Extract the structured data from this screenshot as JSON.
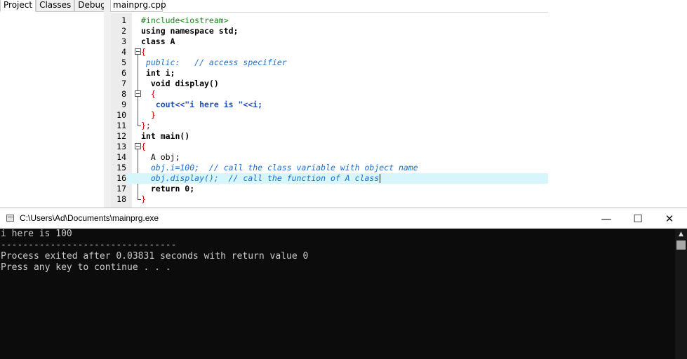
{
  "ide": {
    "left_tabs": [
      "Project",
      "Classes",
      "Debug"
    ],
    "file_tab": "mainprg.cpp",
    "line_numbers": [
      "1",
      "2",
      "3",
      "4",
      "5",
      "6",
      "7",
      "8",
      "9",
      "10",
      "11",
      "12",
      "13",
      "14",
      "15",
      "16",
      "17",
      "18"
    ],
    "lines": {
      "l1": "#include<iostream>",
      "l2": "using namespace std;",
      "l3": "class A",
      "l4": "{",
      "l5": " public:   // access specifier",
      "l6": " int i;",
      "l7": "  void display()",
      "l8": "  {",
      "l9": "   cout<<\"i here is \"<<i;",
      "l10": "  }",
      "l11": "};",
      "l12": "int main()",
      "l13": "{",
      "l14": "  A obj;",
      "l15": "  obj.i=100;  // call the class variable with object name",
      "l16": "  obj.display();  // call the function of A class",
      "l17": "  return 0;",
      "l18": "}"
    }
  },
  "console": {
    "title": "C:\\Users\\Ad\\Documents\\mainprg.exe",
    "buttons": {
      "minimize": "—",
      "maximize": "☐",
      "close": "✕"
    },
    "scroll_up": "▲",
    "output": [
      "i here is 100",
      "--------------------------------",
      "Process exited after 0.03831 seconds with return value 0",
      "Press any key to continue . . ."
    ]
  },
  "colors": {
    "preprocessor": "#0f8a0f",
    "comment": "#1a6fd0",
    "symbol": "#d00000",
    "number": "#7a3ea0",
    "current_line": "#d6f6fb",
    "terminal_bg": "#0c0c0c",
    "terminal_text": "#cccccc"
  }
}
